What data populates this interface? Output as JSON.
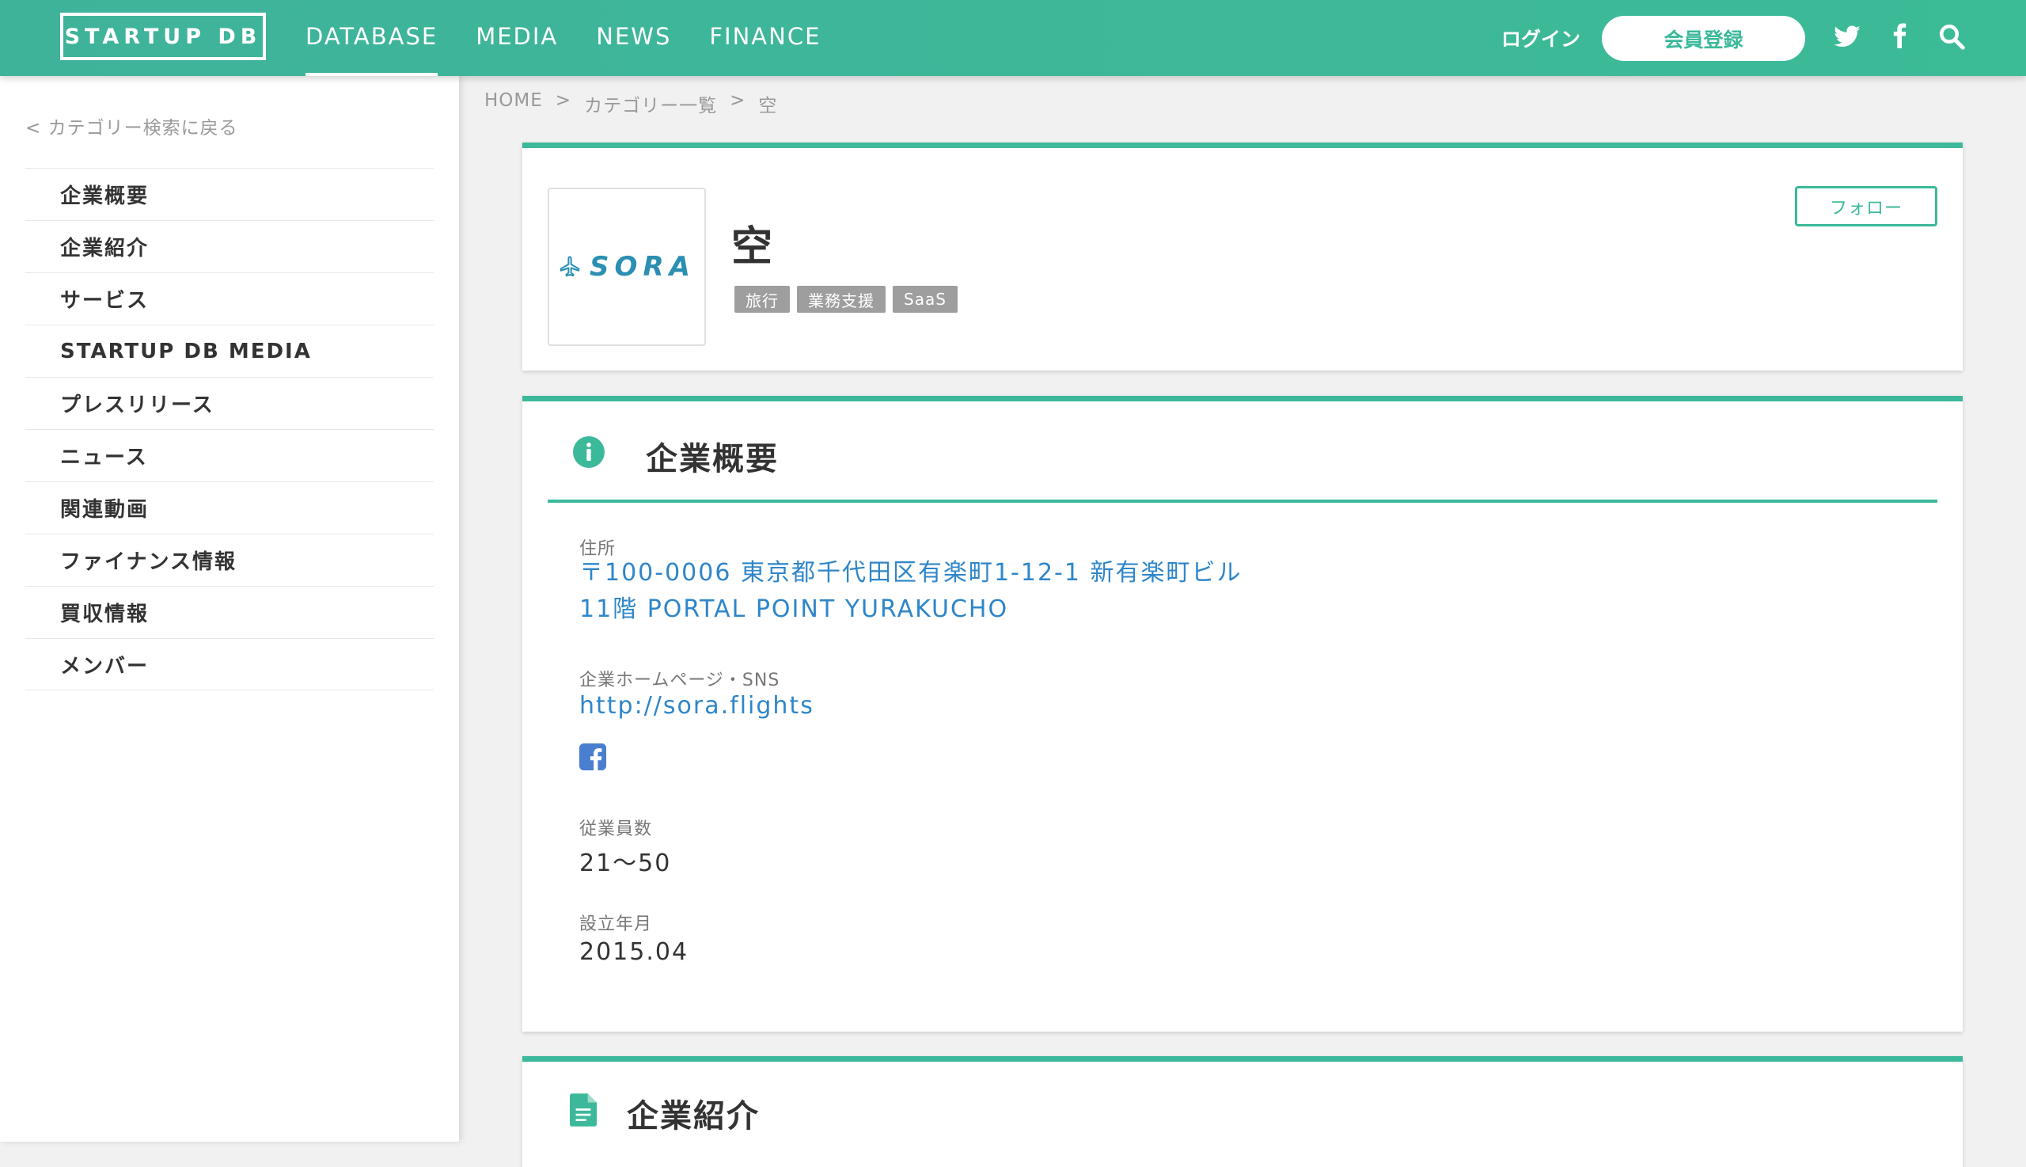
{
  "header": {
    "logo": "STARTUP DB",
    "nav": [
      "DATABASE",
      "MEDIA",
      "NEWS",
      "FINANCE"
    ],
    "active_nav": "DATABASE",
    "login": "ログイン",
    "register": "会員登録",
    "accent_color": "#3cb99a"
  },
  "sidebar": {
    "back_link": "< カテゴリー検索に戻る",
    "items": [
      {
        "label": "企業概要"
      },
      {
        "label": "企業紹介"
      },
      {
        "label": "サービス"
      },
      {
        "label": "STARTUP DB MEDIA"
      },
      {
        "label": "プレスリリース"
      },
      {
        "label": "ニュース"
      },
      {
        "label": "関連動画"
      },
      {
        "label": "ファイナンス情報"
      },
      {
        "label": "買収情報"
      },
      {
        "label": "メンバー"
      }
    ]
  },
  "breadcrumb": {
    "home": "HOME",
    "sep": ">",
    "category": "カテゴリー一覧",
    "current": "空"
  },
  "company": {
    "logo_text": "SORA",
    "name": "空",
    "tags": [
      "旅行",
      "業務支援",
      "SaaS"
    ],
    "follow": "フォロー"
  },
  "overview": {
    "title": "企業概要",
    "address_label": "住所",
    "address_line1": "〒100-0006 東京都千代田区有楽町1-12-1 新有楽町ビル",
    "address_line2": "11階 PORTAL POINT YURAKUCHO",
    "homepage_label": "企業ホームページ・SNS",
    "homepage_url": "http://sora.flights",
    "employees_label": "従業員数",
    "employees_value": "21〜50",
    "founded_label": "設立年月",
    "founded_value": "2015.04"
  },
  "intro": {
    "title": "企業紹介"
  }
}
